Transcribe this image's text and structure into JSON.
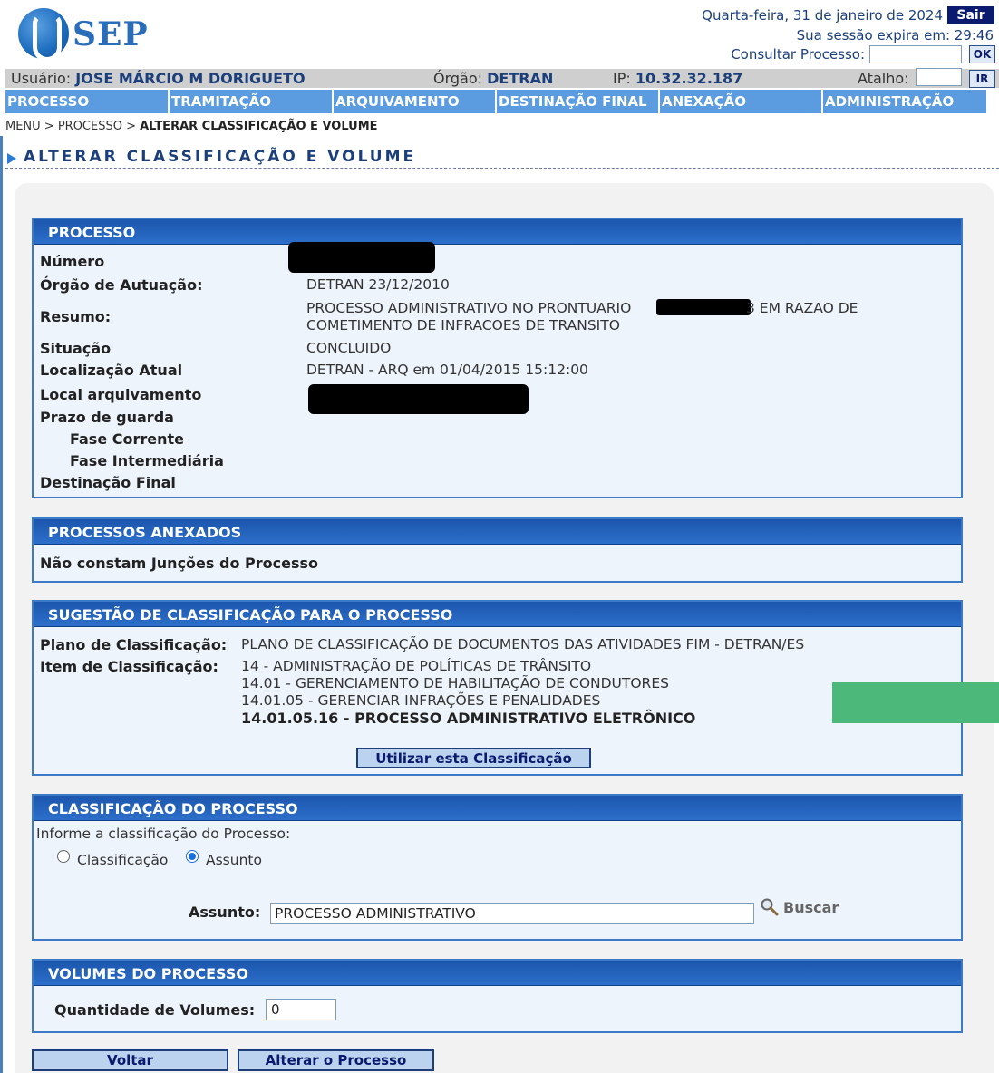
{
  "header": {
    "logo_text": "SEP",
    "date": "Quarta-feira, 31 de janeiro de 2024",
    "logout_label": "Sair",
    "session_label": "Sua sessão expira em: 29:46",
    "consult_label": "Consultar Processo:",
    "consult_value": "",
    "ok_label": "OK",
    "shortcut_label": "Atalho:",
    "shortcut_value": "",
    "go_label": "IR"
  },
  "user_bar": {
    "user_label": "Usuário:",
    "user_value": "JOSE MÁRCIO M DORIGUETO",
    "org_label": "Órgão:",
    "org_value": "DETRAN",
    "ip_label": "IP:",
    "ip_value": "10.32.32.187"
  },
  "menu": [
    "PROCESSO",
    "TRAMITAÇÃO",
    "ARQUIVAMENTO",
    "DESTINAÇÃO FINAL",
    "ANEXAÇÃO",
    "ADMINISTRAÇÃO"
  ],
  "breadcrumb": {
    "part1": "MENU > PROCESSO > ",
    "current": "ALTERAR CLASSIFICAÇÃO E VOLUME"
  },
  "page_title": "ALTERAR CLASSIFICAÇÃO E VOLUME",
  "processo": {
    "title": "PROCESSO",
    "numero_label": "Número",
    "orgao_label": "Órgão de Autuação:",
    "orgao_value": "DETRAN 23/12/2010",
    "resumo_label": "Resumo:",
    "resumo_line1a": "PROCESSO ADMINISTRATIVO NO PRONTUARIO",
    "resumo_line1b": "3 EM RAZAO DE",
    "resumo_line2": "COMETIMENTO DE INFRACOES DE TRANSITO",
    "situacao_label": "Situação",
    "situacao_value": "CONCLUIDO",
    "localizacao_label": "Localização Atual",
    "localizacao_value": "DETRAN - ARQ em 01/04/2015 15:12:00",
    "local_arquivamento_label": "Local arquivamento",
    "prazo_label": "Prazo de guarda",
    "fase_corrente_label": "Fase Corrente",
    "fase_intermediaria_label": "Fase Intermediária",
    "destinacao_label": "Destinação Final"
  },
  "anexados": {
    "title": "PROCESSOS ANEXADOS",
    "message": "Não constam Junções do Processo"
  },
  "sugestao": {
    "title": "SUGESTÃO DE CLASSIFICAÇÃO PARA O PROCESSO",
    "plano_label": "Plano de Classificação:",
    "plano_value": "PLANO DE CLASSIFICAÇÃO DE DOCUMENTOS DAS ATIVIDADES FIM - DETRAN/ES",
    "item_label": "Item de Classificação:",
    "items": [
      "14 - ADMINISTRAÇÃO DE POLÍTICAS DE TRÂNSITO",
      "14.01 - GERENCIAMENTO DE HABILITAÇÃO DE CONDUTORES",
      "14.01.05 - GERENCIAR INFRAÇÕES E PENALIDADES",
      "14.01.05.16 - PROCESSO ADMINISTRATIVO ELETRÔNICO"
    ],
    "button_label": "Utilizar esta Classificação"
  },
  "classificacao": {
    "title": "CLASSIFICAÇÃO DO PROCESSO",
    "instruction": "Informe a classificação do Processo:",
    "option_classificacao": "Classificação",
    "option_assunto": "Assunto",
    "selected": "Assunto",
    "assunto_label": "Assunto:",
    "assunto_value": "PROCESSO ADMINISTRATIVO",
    "buscar_label": "Buscar"
  },
  "volumes": {
    "title": "VOLUMES DO PROCESSO",
    "quantidade_label": "Quantidade de Volumes:",
    "quantidade_value": "0"
  },
  "buttons": {
    "voltar": "Voltar",
    "alterar": "Alterar o Processo"
  },
  "colors": {
    "menu_bg": "#5b9be0",
    "panel_header": "#1c56ad",
    "panel_bg": "#eef4fb",
    "overlay_green": "#4cb87a"
  }
}
